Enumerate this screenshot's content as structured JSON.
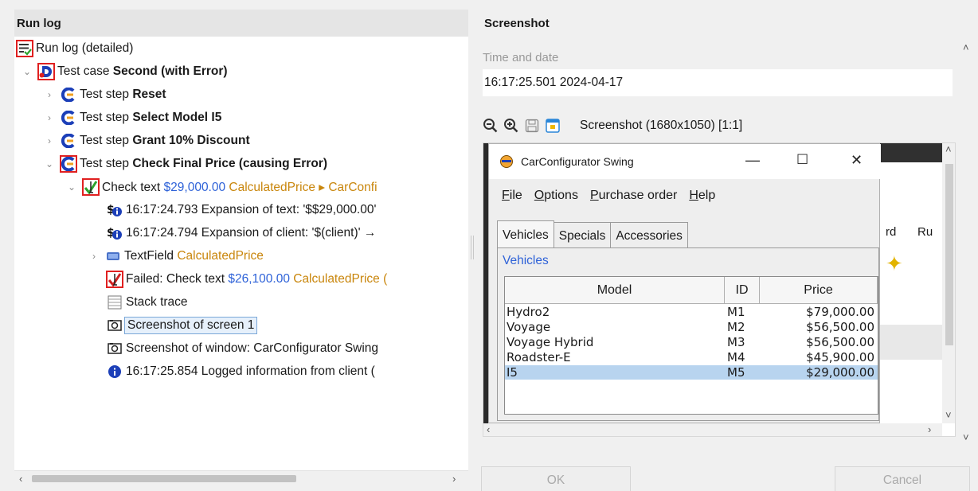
{
  "left": {
    "title": "Run log",
    "tree": [
      {
        "parts": [
          {
            "t": "Run log (detailed)"
          }
        ]
      },
      {
        "parts": [
          {
            "t": "Test case "
          },
          {
            "t": "Second (with Error)",
            "c": "b"
          }
        ]
      },
      {
        "parts": [
          {
            "t": "Test step "
          },
          {
            "t": "Reset",
            "c": "b"
          }
        ]
      },
      {
        "parts": [
          {
            "t": "Test step "
          },
          {
            "t": "Select Model I5",
            "c": "b"
          }
        ]
      },
      {
        "parts": [
          {
            "t": "Test step "
          },
          {
            "t": "Grant 10% Discount",
            "c": "b"
          }
        ]
      },
      {
        "parts": [
          {
            "t": "Test step "
          },
          {
            "t": "Check Final Price (causing Error)",
            "c": "b"
          }
        ]
      },
      {
        "parts": [
          {
            "t": "Check text "
          },
          {
            "t": "$29,000.00",
            "c": "blue"
          },
          {
            "t": " CalculatedPrice ▸ CarConfi",
            "c": "orange"
          }
        ]
      },
      {
        "parts": [
          {
            "t": "16:17:24.793 Expansion of text: '$$29,000.00'"
          }
        ]
      },
      {
        "parts": [
          {
            "t": "16:17:24.794 Expansion of client: '$(client)' →"
          }
        ]
      },
      {
        "parts": [
          {
            "t": "TextField "
          },
          {
            "t": "CalculatedPrice",
            "c": "orange"
          }
        ]
      },
      {
        "parts": [
          {
            "t": "Failed: Check text "
          },
          {
            "t": "$26,100.00",
            "c": "blue"
          },
          {
            "t": " CalculatedPrice (",
            "c": "orange"
          }
        ]
      },
      {
        "parts": [
          {
            "t": "Stack trace"
          }
        ]
      },
      {
        "parts": [
          {
            "t": "Screenshot of screen 1"
          }
        ]
      },
      {
        "parts": [
          {
            "t": "Screenshot of window: CarConfigurator Swing"
          }
        ]
      },
      {
        "parts": [
          {
            "t": "16:17:25.854 Logged information from client ("
          }
        ]
      }
    ]
  },
  "right": {
    "title": "Screenshot",
    "time_label": "Time and date",
    "time_value": "16:17:25.501  2024-04-17",
    "shot_label": "Screenshot (1680x1050) [1:1]",
    "background_fragments": [
      "rd",
      "Ru"
    ],
    "app": {
      "title": "CarConfigurator Swing",
      "menu": [
        "File",
        "Options",
        "Purchase order",
        "Help"
      ],
      "tabs": [
        "Vehicles",
        "Specials",
        "Accessories"
      ],
      "panel_title": "Vehicles",
      "columns": [
        "Model",
        "ID",
        "Price"
      ],
      "rows": [
        {
          "model": "Hydro2",
          "id": "M1",
          "price": "$79,000.00"
        },
        {
          "model": "Voyage",
          "id": "M2",
          "price": "$56,500.00"
        },
        {
          "model": "Voyage Hybrid",
          "id": "M3",
          "price": "$56,500.00"
        },
        {
          "model": "Roadster-E",
          "id": "M4",
          "price": "$45,900.00"
        },
        {
          "model": "I5",
          "id": "M5",
          "price": "$29,000.00"
        }
      ]
    },
    "ok_label": "OK",
    "cancel_label": "Cancel"
  },
  "colors": {
    "accent_blue": "#2e62d8",
    "orange": "#c9860c",
    "error_red": "#e02020",
    "selection": "#b8d4ef"
  }
}
